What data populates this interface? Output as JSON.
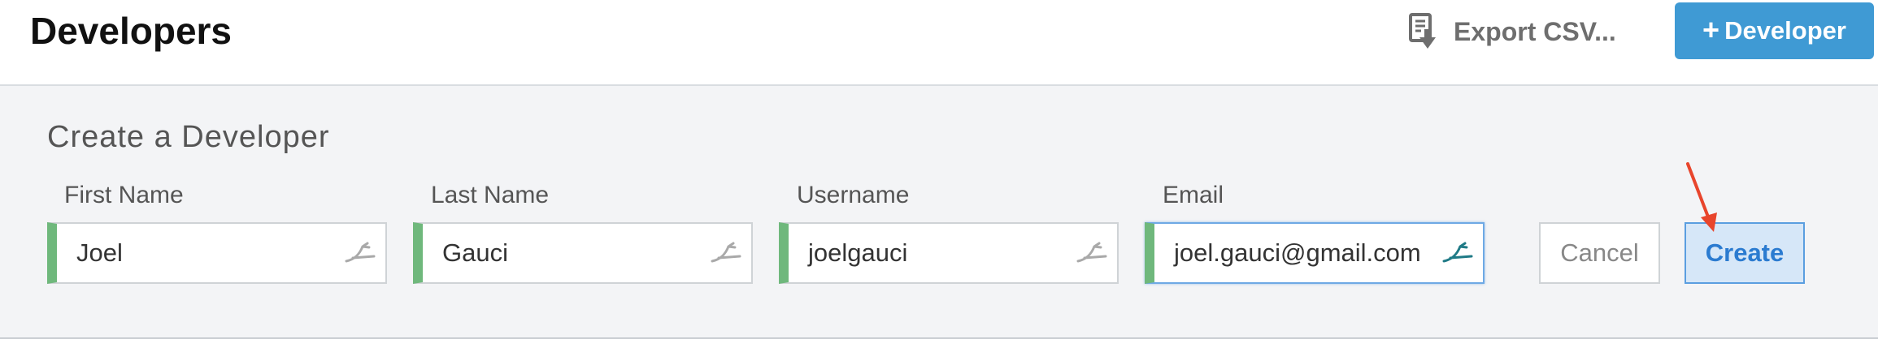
{
  "header": {
    "title": "Developers",
    "export_label": "Export CSV...",
    "export_icon": "export-csv-icon",
    "add_label": "Developer",
    "add_icon": "plus-icon"
  },
  "form": {
    "title": "Create a Developer",
    "fields": [
      {
        "label": "First Name",
        "value": "Joel"
      },
      {
        "label": "Last Name",
        "value": "Gauci"
      },
      {
        "label": "Username",
        "value": "joelgauci"
      },
      {
        "label": "Email",
        "value": "joel.gauci@gmail.com"
      }
    ],
    "field_icon": "autofill-icon",
    "cancel_label": "Cancel",
    "create_label": "Create"
  },
  "colors": {
    "accent_blue": "#3f9ad4",
    "valid_green": "#6fb87c",
    "annotation_red": "#e8452c"
  }
}
